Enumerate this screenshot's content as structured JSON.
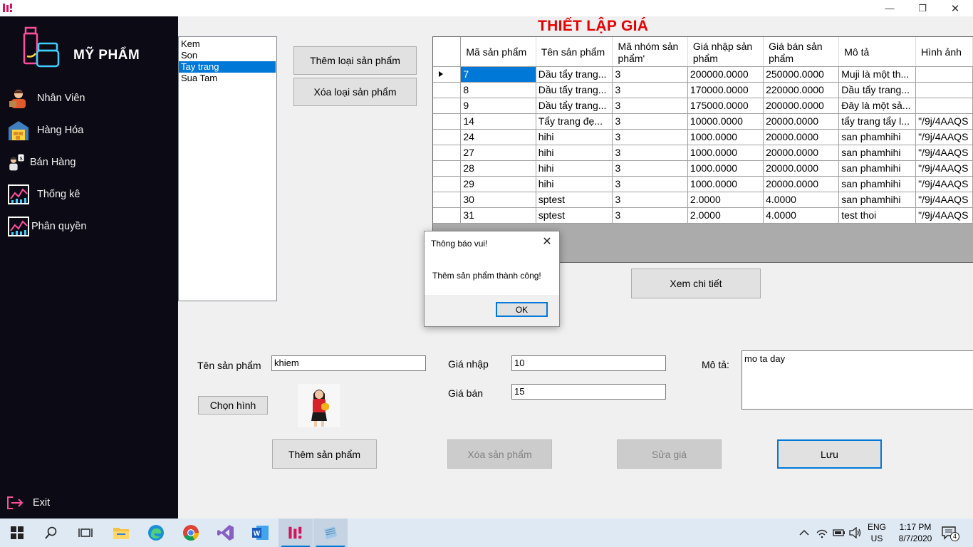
{
  "window": {
    "minimize": "—",
    "restore": "❐",
    "close": "✕"
  },
  "sidebar": {
    "brand": "MỸ PHẨM",
    "items": [
      {
        "label": "Nhân Viên",
        "icon": "staff-icon"
      },
      {
        "label": "Hàng Hóa",
        "icon": "warehouse-icon"
      },
      {
        "label": "Bán Hàng",
        "icon": "seller-icon"
      },
      {
        "label": "Thống kê",
        "icon": "statistics-icon"
      },
      {
        "label": "Phân quyền",
        "icon": "permission-icon"
      }
    ],
    "exit": "Exit"
  },
  "categories": [
    "Kem",
    "Son",
    "Tay trang",
    "Sua Tam"
  ],
  "selected_category": "Tay trang",
  "buttons": {
    "add_category": "Thêm loại sản phẩm",
    "delete_category": "Xóa loại sản phẩm",
    "view_detail": "Xem chi tiết",
    "choose_image": "Chọn hình",
    "add_product": "Thêm sản phẩm",
    "delete_product": "Xóa sản phẩm",
    "edit_price": "Sửa giá",
    "save": "Lưu"
  },
  "title": "THIẾT LẬP GIÁ",
  "grid": {
    "columns": [
      "Mã sản phẩm",
      "Tên sản phẩm",
      "Mã nhóm sản phẩm'",
      "Giá nhập sản phẩm",
      "Giá bán sản phẩm",
      "Mô tả",
      "Hình ảnh"
    ],
    "rows": [
      [
        "7",
        "Dầu tẩy trang...",
        "3",
        "200000.0000",
        "250000.0000",
        "Muji là một th...",
        ""
      ],
      [
        "8",
        "Dầu tẩy trang...",
        "3",
        "170000.0000",
        "220000.0000",
        "Dầu tẩy trang...",
        ""
      ],
      [
        "9",
        "Dầu tẩy trang...",
        "3",
        "175000.0000",
        "200000.0000",
        "Đây là một sả...",
        ""
      ],
      [
        "14",
        "Tẩy trang đẹ...",
        "3",
        "10000.0000",
        "20000.0000",
        "tẩy trang tẩy l...",
        "\"/9j/4AAQS"
      ],
      [
        "24",
        "hihi",
        "3",
        "1000.0000",
        "20000.0000",
        "san phamhihi",
        "\"/9j/4AAQS"
      ],
      [
        "27",
        "hihi",
        "3",
        "1000.0000",
        "20000.0000",
        "san phamhihi",
        "\"/9j/4AAQS"
      ],
      [
        "28",
        "hihi",
        "3",
        "1000.0000",
        "20000.0000",
        "san phamhihi",
        "\"/9j/4AAQS"
      ],
      [
        "29",
        "hihi",
        "3",
        "1000.0000",
        "20000.0000",
        "san phamhihi",
        "\"/9j/4AAQS"
      ],
      [
        "30",
        "sptest",
        "3",
        "2.0000",
        "4.0000",
        "san phamhihi",
        "\"/9j/4AAQS"
      ],
      [
        "31",
        "sptest",
        "3",
        "2.0000",
        "4.0000",
        "test thoi",
        "\"/9j/4AAQS"
      ]
    ]
  },
  "form": {
    "name_label": "Tên sản phẩm",
    "name_value": "khiem",
    "import_label": "Giá nhập",
    "import_value": "10",
    "sell_label": "Giá bán",
    "sell_value": "15",
    "desc_label": "Mô tả:",
    "desc_value": "mo ta day"
  },
  "dialog": {
    "title": "Thông báo vui!",
    "message": "Thêm sản phẩm thành công!",
    "ok": "OK",
    "close": "✕"
  },
  "taskbar": {
    "lang_top": "ENG",
    "lang_bottom": "US",
    "time": "1:17 PM",
    "date": "8/7/2020",
    "notifications": "4"
  },
  "colors": {
    "sidebar_bg": "#0c0b15",
    "title_red": "#e60000",
    "selection_blue": "#0078d7"
  }
}
